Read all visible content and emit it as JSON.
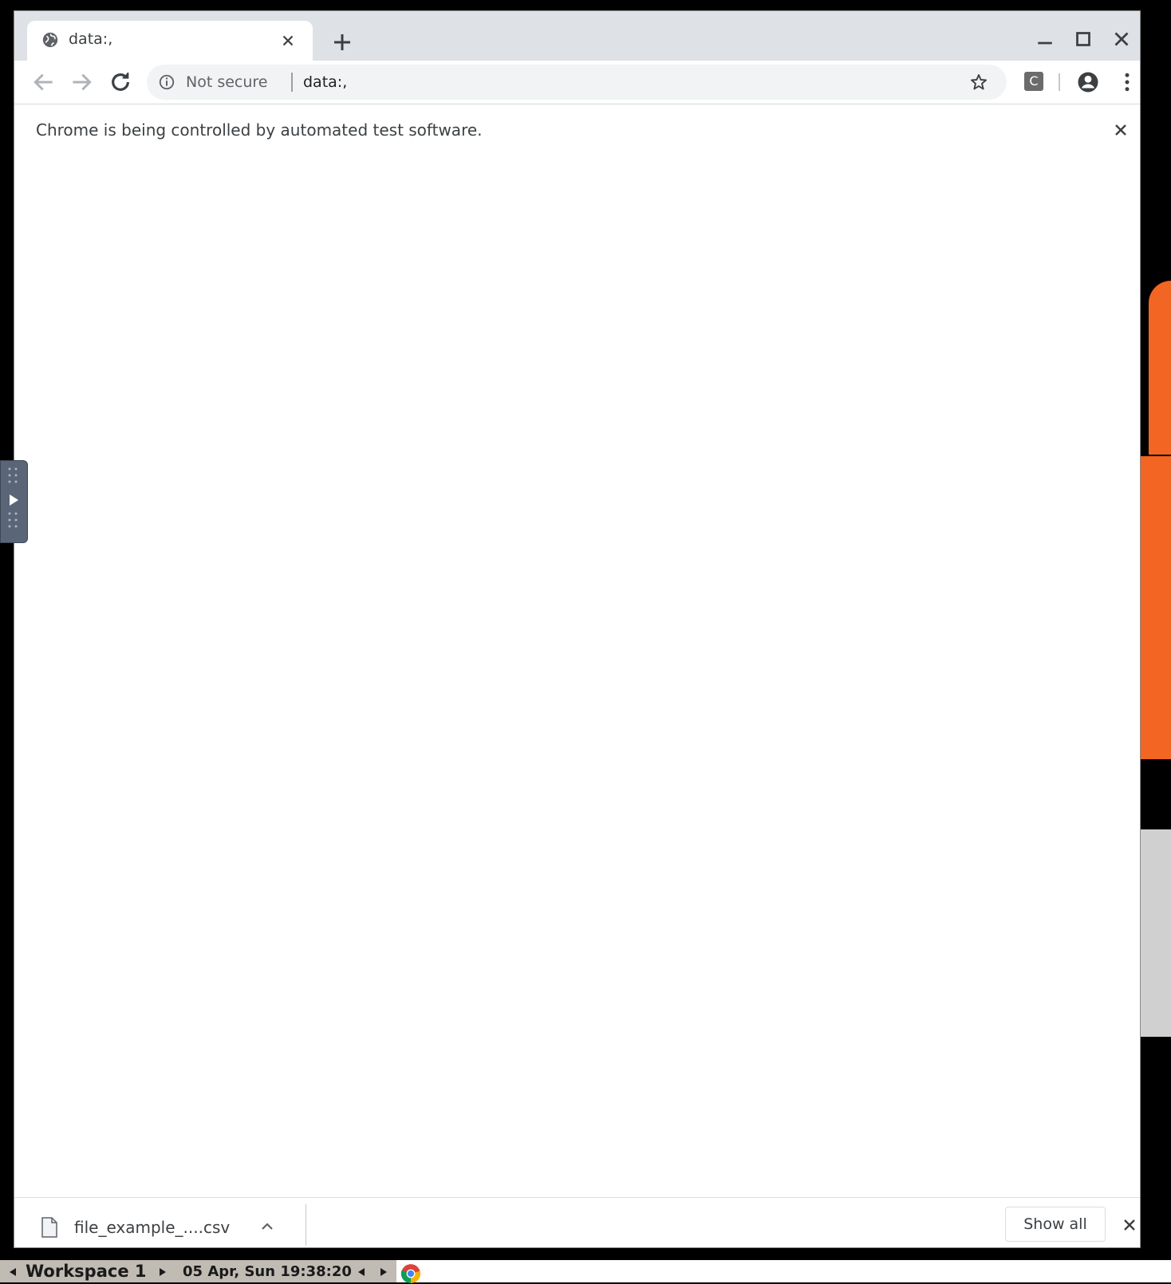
{
  "browser": {
    "tab": {
      "title": "data:,",
      "favicon": "globe-icon"
    },
    "new_tab_icon": "plus-icon",
    "window_controls": [
      "minimize-icon",
      "maximize-icon",
      "close-icon"
    ],
    "toolbar": {
      "back_icon": "arrow-left-icon",
      "forward_icon": "arrow-right-icon",
      "reload_icon": "reload-icon",
      "security_label": "Not secure",
      "url": "data:,",
      "extension_letter": "C"
    },
    "infobar": {
      "message": "Chrome is being controlled by automated test software."
    },
    "download_bar": {
      "file_name": "file_example_....csv",
      "show_all_label": "Show all"
    }
  },
  "taskbar": {
    "workspace": "Workspace 1",
    "clock": "05 Apr, Sun 19:38:20"
  },
  "colors": {
    "desktop_orange": "#f26522",
    "titlebar": "#dee1e6",
    "omnibox": "#f1f3f4"
  }
}
